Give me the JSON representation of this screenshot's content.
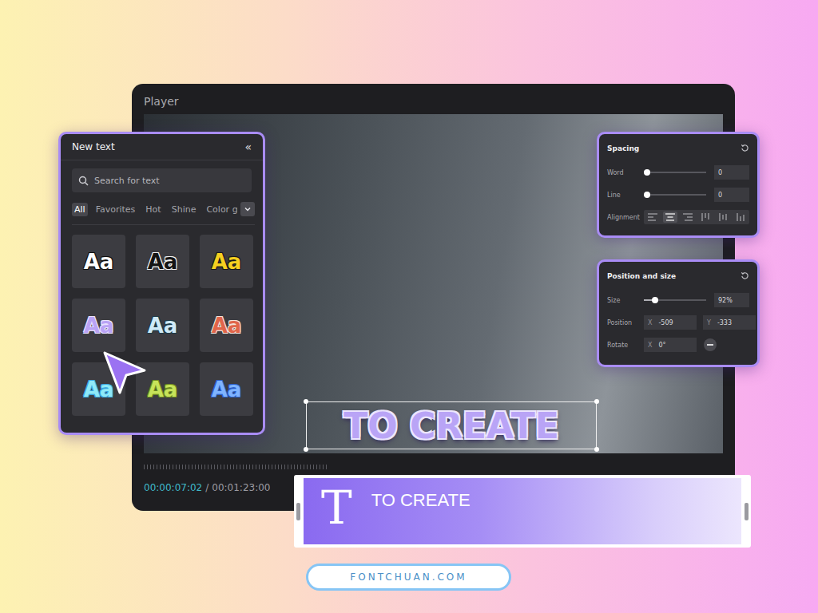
{
  "player": {
    "title": "Player",
    "current_time": "00:00:07:02",
    "separator": "/",
    "total_time": "00:01:23:00"
  },
  "canvas_text": {
    "text": "TO CREATE",
    "selected": true
  },
  "text_panel": {
    "title": "New text",
    "collapse_icon": "«",
    "search": {
      "placeholder": "Search for text"
    },
    "tabs": [
      {
        "label": "All",
        "selected": true
      },
      {
        "label": "Favorites",
        "selected": false
      },
      {
        "label": "Hot",
        "selected": false
      },
      {
        "label": "Shine",
        "selected": false
      },
      {
        "label": "Color g",
        "selected": false
      }
    ],
    "presets": [
      {
        "label": "Aa",
        "color": "#ffffff",
        "outline": "#111111"
      },
      {
        "label": "Aa",
        "color": "#151515",
        "outline": "#f2f2f2"
      },
      {
        "label": "Aa",
        "color": "#f5d020",
        "outline": "#1a1a1a"
      },
      {
        "label": "Aa",
        "color": "#b9a3f5",
        "outline": "#e9e2ff"
      },
      {
        "label": "Aa",
        "color": "#cfeaf7",
        "outline": "#1d3a48"
      },
      {
        "label": "Aa",
        "color": "#e0654a",
        "outline": "#f3e0d8"
      },
      {
        "label": "Aa",
        "color": "#8fe9f7",
        "outline": "#3aa7e0"
      },
      {
        "label": "Aa",
        "color": "#c7e35a",
        "outline": "#6d8a20"
      },
      {
        "label": "Aa",
        "color": "#7fb4ff",
        "outline": "#2b5fc9"
      }
    ]
  },
  "spacing_panel": {
    "title": "Spacing",
    "sliders": [
      {
        "label": "Word",
        "level": 0.05,
        "value": "0"
      },
      {
        "label": "Line",
        "level": 0.05,
        "value": "0"
      }
    ],
    "alignment": {
      "label": "Alignment",
      "options": [
        {
          "kind": "left",
          "selected": false
        },
        {
          "kind": "center",
          "selected": true
        },
        {
          "kind": "right",
          "selected": false
        },
        {
          "kind": "top",
          "selected": false
        },
        {
          "kind": "middle",
          "selected": false
        },
        {
          "kind": "bottom",
          "selected": false
        }
      ]
    }
  },
  "position_panel": {
    "title": "Position and size",
    "size": {
      "label": "Size",
      "level": 0.18,
      "value": "92%"
    },
    "position": {
      "label": "Position",
      "x_label": "X",
      "x": "-509",
      "y_label": "Y",
      "y": "-333"
    },
    "rotate": {
      "label": "Rotate",
      "x_label": "X",
      "value": "0°"
    }
  },
  "timeline_clip": {
    "icon": "T",
    "label": "TO CREATE"
  },
  "footer": {
    "text": "FONTCHUAN.COM"
  }
}
